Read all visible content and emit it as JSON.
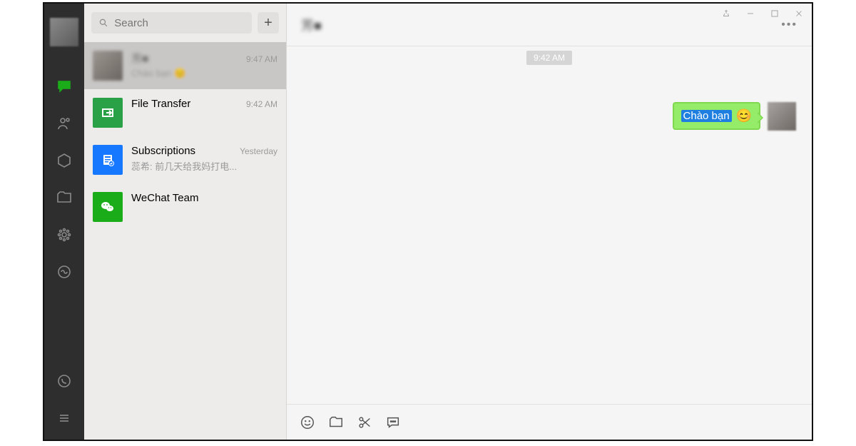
{
  "window_controls": {
    "pin": "pin",
    "minimize": "minimize",
    "maximize": "maximize",
    "close": "close"
  },
  "rail": {
    "items": [
      {
        "name": "chat-icon",
        "active": true
      },
      {
        "name": "contacts-icon"
      },
      {
        "name": "favorites-icon"
      },
      {
        "name": "files-icon"
      },
      {
        "name": "moments-icon"
      },
      {
        "name": "miniprogram-icon"
      }
    ],
    "bottom": [
      {
        "name": "phone-icon"
      },
      {
        "name": "menu-icon"
      }
    ]
  },
  "search": {
    "placeholder": "Search"
  },
  "add_button": {
    "glyph": "+"
  },
  "conversations": [
    {
      "name_blurred": "芳■",
      "time": "9:47 AM",
      "preview": "Chào bạn",
      "emoji": "😊",
      "selected": true,
      "avatar": "blur"
    },
    {
      "name": "File Transfer",
      "time": "9:42 AM",
      "preview": "",
      "avatar": "filetransfer"
    },
    {
      "name": "Subscriptions",
      "time": "Yesterday",
      "preview": "蕊希: 前几天给我妈打电...",
      "avatar": "subscriptions"
    },
    {
      "name": "WeChat Team",
      "time": "",
      "preview": "",
      "avatar": "wechat"
    }
  ],
  "chat": {
    "title_blurred": "芳■",
    "timestamp_pill": "9:42 AM",
    "messages": [
      {
        "from": "me",
        "text": "Chào bạn",
        "emoji": "😊"
      }
    ],
    "toolbar_icons": [
      "emoji-icon",
      "folder-icon",
      "scissors-icon",
      "chat-log-icon"
    ]
  }
}
